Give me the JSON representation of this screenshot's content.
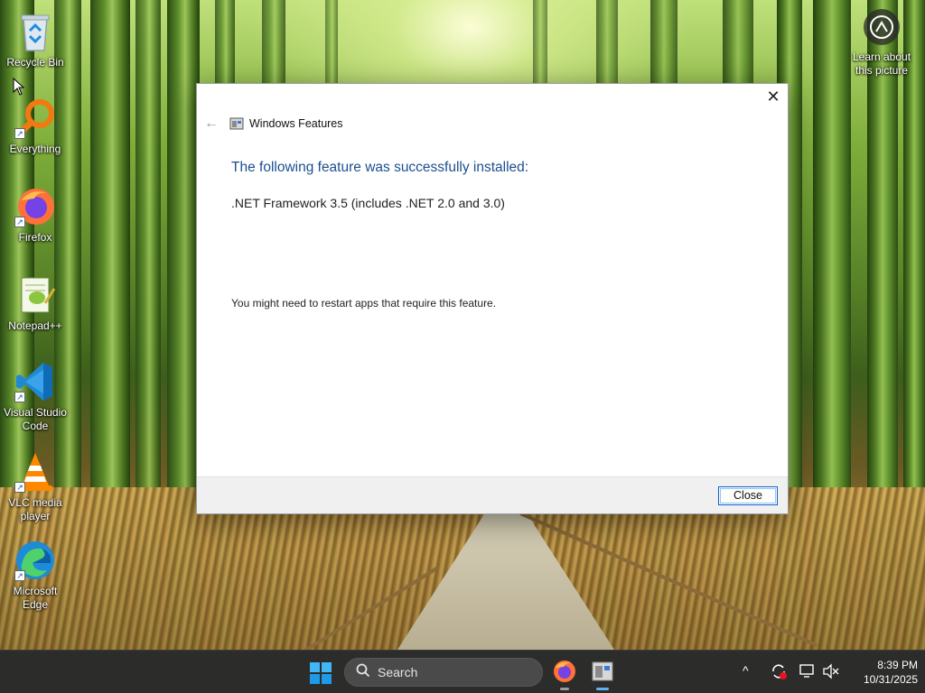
{
  "desktop": {
    "icons": [
      {
        "label": "Recycle Bin",
        "icon": "recycle-bin-icon"
      },
      {
        "label": "Everything",
        "icon": "everything-search-icon"
      },
      {
        "label": "Firefox",
        "icon": "firefox-icon"
      },
      {
        "label": "Notepad++",
        "icon": "notepadpp-icon"
      },
      {
        "label": "Visual Studio Code",
        "icon": "vscode-icon"
      },
      {
        "label": "VLC media player",
        "icon": "vlc-icon"
      },
      {
        "label": "Microsoft Edge",
        "icon": "edge-icon"
      }
    ],
    "learn_about_picture": "Learn about this picture"
  },
  "dialog": {
    "title": "Windows Features",
    "heading": "The following feature was successfully installed:",
    "feature": ".NET Framework 3.5 (includes .NET 2.0 and 3.0)",
    "note": "You might need to restart apps that require this feature.",
    "close_button": "Close",
    "close_glyph": "✕",
    "back_glyph": "←"
  },
  "taskbar": {
    "search_placeholder": "Search",
    "apps": [
      {
        "name": "firefox-icon",
        "active": false
      },
      {
        "name": "windows-features-icon",
        "active": true
      }
    ],
    "tray_chevron": "^",
    "time": "8:39 PM",
    "date": "10/31/2025"
  },
  "colors": {
    "heading": "#1c4f8f",
    "accent": "#0a64c8",
    "taskbar": "#2c2c2c"
  }
}
